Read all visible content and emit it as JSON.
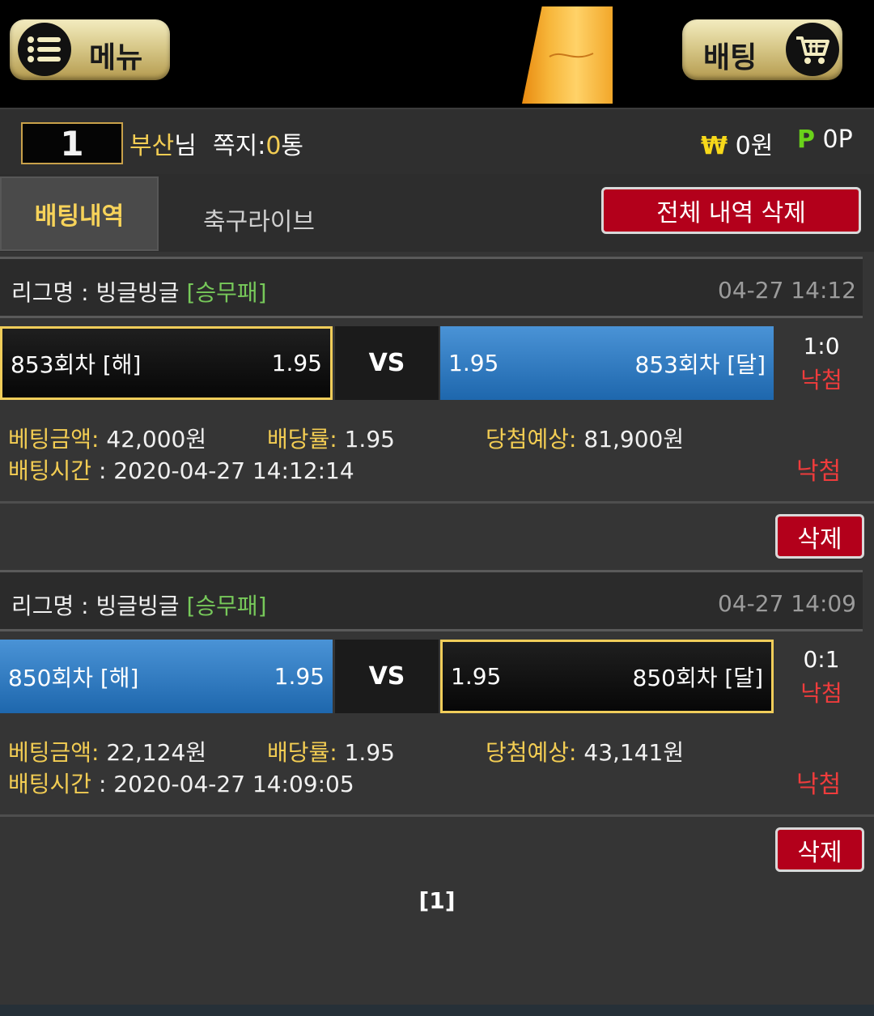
{
  "header": {
    "menu_label": "메뉴",
    "betting_label": "배팅",
    "menu_icon": "list-icon",
    "cart_icon": "cart-icon"
  },
  "user": {
    "level": "1",
    "name": "부산",
    "name_suffix": "님",
    "message_label": "쪽지:",
    "message_count": "0",
    "message_unit": "통",
    "won_symbol": "₩",
    "money": "0원",
    "point_symbol": "P",
    "points": "0P"
  },
  "tabs": {
    "active": "배팅내역",
    "inactive": "축구라이브",
    "delete_all": "전체 내역 삭제"
  },
  "bets": [
    {
      "league_label": "리그명 : 빙글빙글 ",
      "category": "[승무패]",
      "time": "04-27 14:12",
      "home_team": "853회차 [해]",
      "home_odds": "1.95",
      "vs": "VS",
      "away_odds": "1.95",
      "away_team": "853회차 [달]",
      "selected": "home",
      "score": "1:0",
      "result": "낙첨",
      "amount_label": "베팅금액:",
      "amount": " 42,000원",
      "rate_label": "배당률:",
      "rate": " 1.95",
      "expected_label": "당첨예상:",
      "expected": " 81,900원",
      "time_label": "배팅시간",
      "bet_time": " : 2020-04-27 14:12:14",
      "status": "낙첨",
      "delete": "삭제"
    },
    {
      "league_label": "리그명 : 빙글빙글 ",
      "category": "[승무패]",
      "time": "04-27 14:09",
      "home_team": "850회차 [해]",
      "home_odds": "1.95",
      "vs": "VS",
      "away_odds": "1.95",
      "away_team": "850회차 [달]",
      "selected": "away",
      "score": "0:1",
      "result": "낙첨",
      "amount_label": "베팅금액:",
      "amount": " 22,124원",
      "rate_label": "배당률:",
      "rate": " 1.95",
      "expected_label": "당첨예상:",
      "expected": " 43,141원",
      "time_label": "배팅시간",
      "bet_time": " : 2020-04-27 14:09:05",
      "status": "낙첨",
      "delete": "삭제"
    }
  ],
  "pagination": "[1]",
  "colors": {
    "gold": "#f3cd53",
    "red": "#b3001b",
    "lost": "#ef3c3c",
    "category": "#77c95a",
    "blue": "#2f7cc4"
  }
}
